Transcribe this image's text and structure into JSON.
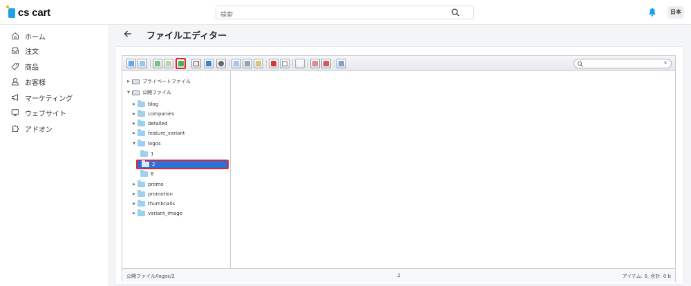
{
  "brand": {
    "logo_text": "cs cart"
  },
  "header": {
    "search_placeholder": "検索",
    "language": "日本"
  },
  "sidebar": {
    "items": [
      {
        "label": "ホーム",
        "icon": "home-icon"
      },
      {
        "label": "注文",
        "icon": "inbox-icon"
      },
      {
        "label": "商品",
        "icon": "tag-icon"
      },
      {
        "label": "お客様",
        "icon": "user-icon"
      },
      {
        "label": "マーケティング",
        "icon": "megaphone-icon"
      },
      {
        "label": "ウェブサイト",
        "icon": "monitor-icon"
      },
      {
        "label": "アドオン",
        "icon": "puzzle-icon"
      }
    ]
  },
  "page": {
    "title": "ファイルエディター"
  },
  "file_manager": {
    "search_value": "",
    "search_clear": "×",
    "tree": {
      "private": "プライベートファイル",
      "public": "公開ファイル",
      "folders": [
        "blog",
        "companies",
        "detailed",
        "feature_variant",
        "logos"
      ],
      "logos_children": [
        "1",
        "2",
        "8"
      ],
      "folders_after": [
        "promo",
        "promotion",
        "thumbnails",
        "variant_image"
      ],
      "selected": "2"
    },
    "status": {
      "path": "公開ファイル/logos/2",
      "name": "2",
      "summary": "アイテム: 0, 合計: 0 b"
    }
  },
  "colors": {
    "accent": "#2f6fd8",
    "highlight": "#d62b3a",
    "folder": "#9fd0f0",
    "bell": "#1aa3e8"
  }
}
